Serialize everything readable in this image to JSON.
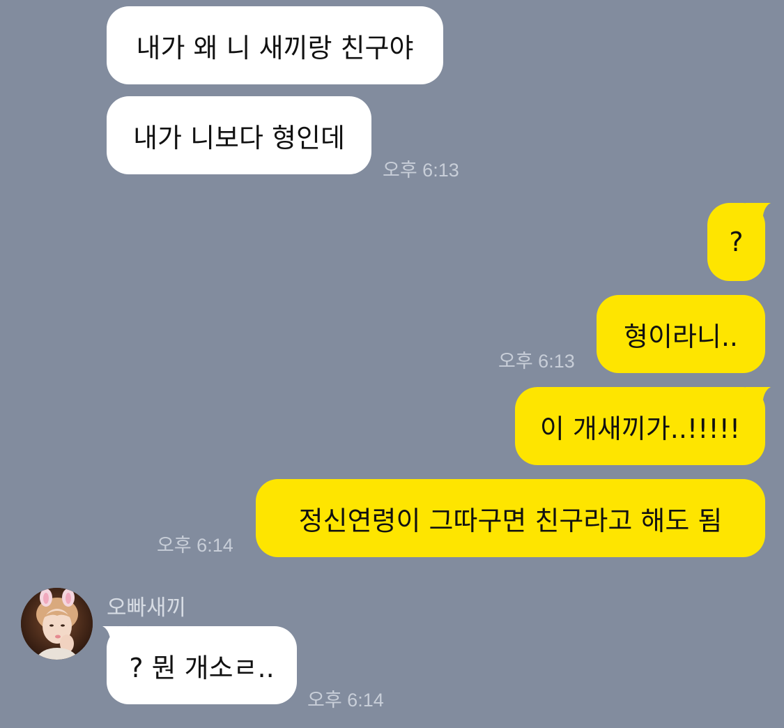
{
  "messages": [
    {
      "from": "other",
      "text": "내가 왜 니 새끼랑 친구야"
    },
    {
      "from": "other",
      "text": "내가 니보다 형인데",
      "time": "오후 6:13"
    },
    {
      "from": "me",
      "text": "?"
    },
    {
      "from": "me",
      "text": "형이라니..",
      "time": "오후 6:13"
    },
    {
      "from": "me",
      "text": "이 개새끼가..!!!!!"
    },
    {
      "from": "me",
      "text": "정신연령이 그따구면 친구라고 해도 됨",
      "time": "오후 6:14"
    },
    {
      "from": "other",
      "sender": "오빠새끼",
      "avatar": "profile-photo",
      "text": "? 뭔 개소ㄹ..",
      "time": "오후 6:14"
    }
  ],
  "colors": {
    "background": "#828c9e",
    "incoming_bubble": "#ffffff",
    "outgoing_bubble": "#fee500",
    "timestamp": "#c8ced8"
  }
}
